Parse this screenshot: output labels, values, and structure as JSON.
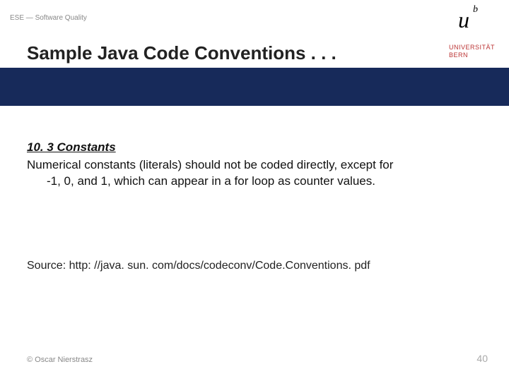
{
  "header": {
    "label": "ESE — Software Quality"
  },
  "title": "Sample Java Code Conventions . . .",
  "logo": {
    "u": "u",
    "b": "b",
    "uni_line1": "UNIVERSITÄT",
    "uni_line2": "BERN"
  },
  "section": {
    "heading": "10. 3 Constants",
    "line1": "Numerical constants (literals) should not be coded directly, except for",
    "line2": "-1, 0, and 1, which can appear in a for loop as counter values."
  },
  "source": "Source: http: //java. sun. com/docs/codeconv/Code.Conventions. pdf",
  "footer": {
    "left": "© Oscar Nierstrasz",
    "right": "40"
  }
}
